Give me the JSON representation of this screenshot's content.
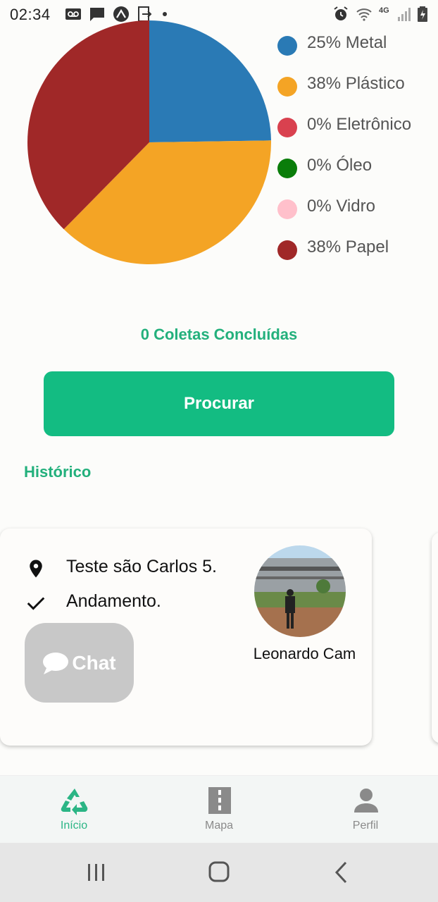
{
  "status_bar": {
    "time": "02:34",
    "left_icons": [
      "voicemail-icon",
      "message-icon",
      "expo-icon",
      "exit-icon"
    ],
    "right_icons": [
      "alarm-icon",
      "wifi-icon",
      "network-4g-icon",
      "signal-icon",
      "battery-icon"
    ],
    "network_label": "4G"
  },
  "chart_data": {
    "type": "pie",
    "slices": [
      {
        "label": "Metal",
        "value": 25,
        "color": "#2a7ab5"
      },
      {
        "label": "Plástico",
        "value": 38,
        "color": "#f4a425"
      },
      {
        "label": "Eletrônico",
        "value": 0,
        "color": "#d9414f"
      },
      {
        "label": "Óleo",
        "value": 0,
        "color": "#0a7d0a"
      },
      {
        "label": "Vidro",
        "value": 0,
        "color": "#ffc0cb"
      },
      {
        "label": "Papel",
        "value": 38,
        "color": "#a02828"
      }
    ],
    "legend": [
      {
        "text": "25% Metal",
        "color": "#2a7ab5"
      },
      {
        "text": "38% Plástico",
        "color": "#f4a425"
      },
      {
        "text": "0% Eletrônico",
        "color": "#d9414f"
      },
      {
        "text": "0% Óleo",
        "color": "#0a7d0a"
      },
      {
        "text": "0% Vidro",
        "color": "#ffc0cb"
      },
      {
        "text": "38% Papel",
        "color": "#a02828"
      }
    ],
    "legend_position": "right"
  },
  "summary": {
    "completed_text": "0 Coletas Concluídas"
  },
  "search_button": {
    "label": "Procurar"
  },
  "history": {
    "title": "Histórico",
    "card": {
      "location": "Teste são Carlos 5.",
      "location_icon": "map-pin-icon",
      "status": "Andamento.",
      "status_icon": "check-icon",
      "chat_label": "Chat",
      "chat_icon": "chat-bubble-icon",
      "person_name": "Leonardo Cam"
    }
  },
  "bottom_nav": {
    "items": [
      {
        "label": "Início",
        "icon": "recycle-icon",
        "active": true
      },
      {
        "label": "Mapa",
        "icon": "road-icon",
        "active": false
      },
      {
        "label": "Perfil",
        "icon": "person-icon",
        "active": false
      }
    ],
    "active_color": "#2bb585",
    "inactive_color": "#8a8a8a"
  },
  "system_nav": {
    "icons": [
      "recent-apps-icon",
      "home-icon",
      "back-icon"
    ]
  }
}
